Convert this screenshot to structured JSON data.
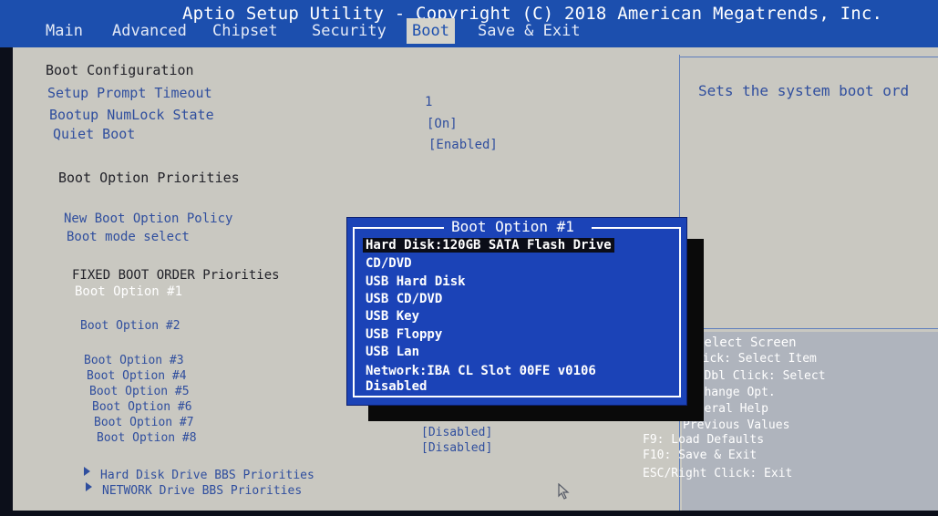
{
  "title": "Aptio Setup Utility - Copyright (C) 2018 American Megatrends, Inc.",
  "tabs": [
    "Main",
    "Advanced",
    "Chipset",
    "Security",
    "Boot",
    "Save & Exit"
  ],
  "active_tab": "Boot",
  "boot_config": {
    "heading": "Boot Configuration",
    "setup_prompt_timeout_label": "Setup Prompt Timeout",
    "setup_prompt_timeout_value": "1",
    "numlock_label": "Bootup NumLock State",
    "numlock_value": "[On]",
    "quiet_boot_label": "Quiet Boot",
    "quiet_boot_value": "[Enabled]"
  },
  "priorities": {
    "heading": "Boot Option Priorities",
    "new_policy_label": "New Boot Option Policy",
    "boot_mode_label": "Boot mode select"
  },
  "fixed": {
    "heading": "FIXED BOOT ORDER Priorities",
    "option1": "Boot Option #1",
    "option2": "Boot Option #2",
    "option3": "Boot Option #3",
    "option4": "Boot Option #4",
    "option5": "Boot Option #5",
    "option6": "Boot Option #6",
    "option7": "Boot Option #7",
    "option8": "Boot Option #8",
    "option7_value": "[Disabled]",
    "option8_value": "[Disabled]"
  },
  "submenus": {
    "hdd_bbs": "Hard Disk Drive BBS Priorities",
    "network_bbs": "NETWORK Drive BBS Priorities"
  },
  "help": {
    "description": "Sets the system boot ord",
    "keys": [
      "Select Screen",
      "Click: Select Item",
      "er/Dbl Click: Select",
      ": Change Opt.",
      "General Help",
      "Previous Values",
      "F9: Load Defaults",
      "F10: Save & Exit",
      "ESC/Right Click: Exit"
    ]
  },
  "popup": {
    "title": "Boot Option #1",
    "options": [
      "Hard Disk:120GB SATA Flash Drive",
      "CD/DVD",
      "USB Hard Disk",
      "USB CD/DVD",
      "USB Key",
      "USB Floppy",
      "USB Lan",
      "Network:IBA CL Slot 00FE v0106",
      "Disabled"
    ],
    "selected_index": 0
  },
  "colors": {
    "background": "#c9c8c1",
    "accent_blue": "#1b43b7",
    "text_blue": "#2f4e9e"
  }
}
